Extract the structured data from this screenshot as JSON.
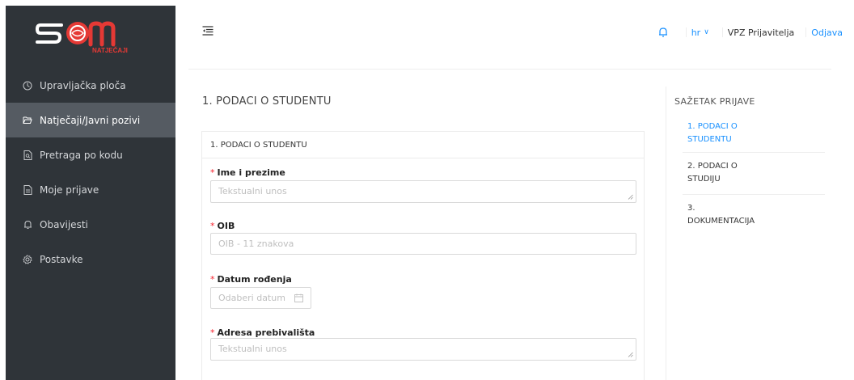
{
  "logo": {
    "brand_text": "NATJEČAJI",
    "accent": "#e53935"
  },
  "sidebar": {
    "items": [
      {
        "label": "Upravljačka ploča",
        "icon": "dashboard-icon"
      },
      {
        "label": "Natječaji/Javni pozivi",
        "icon": "folder-open-icon",
        "active": true
      },
      {
        "label": "Pretraga po kodu",
        "icon": "file-search-icon"
      },
      {
        "label": "Moje prijave",
        "icon": "file-icon"
      },
      {
        "label": "Obavijesti",
        "icon": "bell-icon"
      },
      {
        "label": "Postavke",
        "icon": "gear-icon"
      }
    ]
  },
  "header": {
    "language": "hr",
    "user": "VPZ Prijavitelja",
    "logout": "Odjava"
  },
  "main": {
    "section_title": "1. PODACI O STUDENTU",
    "card_title": "1. PODACI O STUDENTU",
    "fields": {
      "name": {
        "label": "Ime i prezime",
        "placeholder": "Tekstualni unos"
      },
      "oib": {
        "label": "OIB",
        "placeholder": "OIB - 11 znakova"
      },
      "dob": {
        "label": "Datum rođenja",
        "placeholder": "Odaberi datum"
      },
      "address": {
        "label": "Adresa prebivališta",
        "placeholder": "Tekstualni unos"
      }
    }
  },
  "summary": {
    "title": "SAŽETAK PRIJAVE",
    "items": [
      {
        "line1": "1. PODACI O",
        "line2": "STUDENTU"
      },
      {
        "line1": "2. PODACI O",
        "line2": "STUDIJU"
      },
      {
        "line1": "3.",
        "line2": "DOKUMENTACIJA"
      }
    ]
  },
  "colors": {
    "sidebar_bg": "#2f3439",
    "active_bg": "#555b62",
    "link": "#1890ff",
    "required": "#f5222d"
  }
}
